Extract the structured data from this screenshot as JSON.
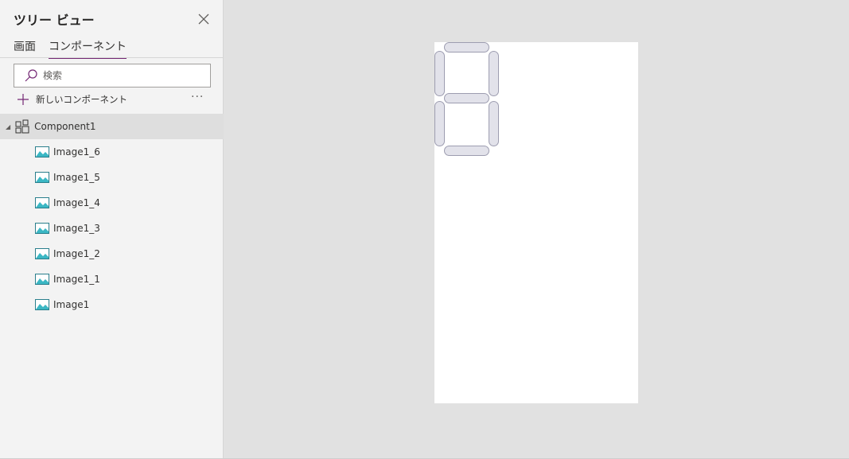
{
  "panel": {
    "title": "ツリー ビュー",
    "tabs": [
      {
        "label": "画面",
        "active": false
      },
      {
        "label": "コンポーネント",
        "active": true
      }
    ],
    "search": {
      "placeholder": "検索",
      "value": ""
    },
    "new_component_label": "新しいコンポーネント",
    "more_label": "···"
  },
  "tree": {
    "root": {
      "label": "Component1",
      "expanded": true
    },
    "items": [
      {
        "label": "Image1_6"
      },
      {
        "label": "Image1_5"
      },
      {
        "label": "Image1_4"
      },
      {
        "label": "Image1_3"
      },
      {
        "label": "Image1_2"
      },
      {
        "label": "Image1_1"
      },
      {
        "label": "Image1"
      }
    ]
  },
  "colors": {
    "accent": "#742774",
    "panel_bg": "#f3f3f3",
    "workspace_bg": "#e1e1e1",
    "selected_row": "#dedede",
    "segment_fill": "#e2e2ea",
    "segment_border": "#9d9db0"
  },
  "icons": {
    "close": "close-icon",
    "search": "search-icon",
    "add": "plus-icon",
    "component": "component-icon",
    "image": "image-icon",
    "expand": "caret-down-icon"
  }
}
